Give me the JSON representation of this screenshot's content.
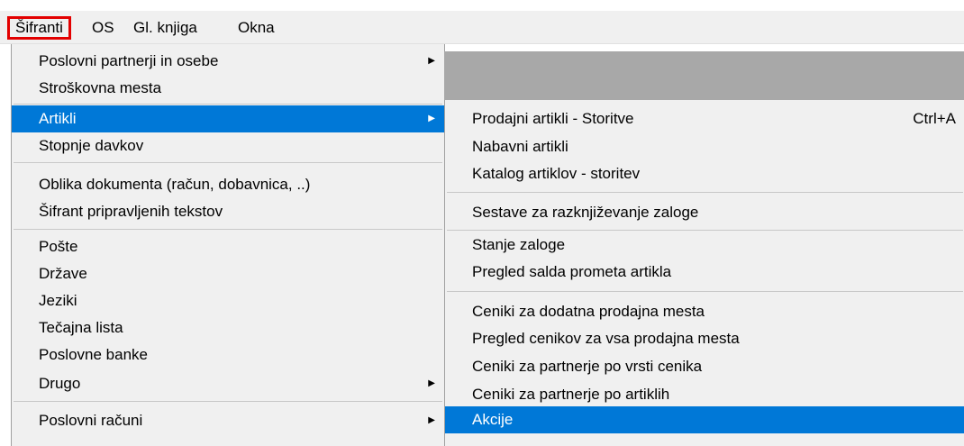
{
  "menubar": {
    "items": [
      {
        "label": "Šifranti",
        "active": true
      },
      {
        "label": "OS",
        "active": false
      },
      {
        "label": "Gl. knjiga",
        "active": false
      },
      {
        "label": "Okna",
        "active": false
      }
    ]
  },
  "main_menu": {
    "items": [
      {
        "label": "Poslovni partnerji in osebe",
        "submenu": true
      },
      {
        "label": "Stroškovna mesta"
      },
      {
        "label": "Artikli",
        "submenu": true,
        "selected": true
      },
      {
        "label": "Stopnje davkov"
      },
      {
        "label": "Oblika dokumenta (račun, dobavnica, ..)"
      },
      {
        "label": "Šifrant pripravljenih tekstov"
      },
      {
        "label": "Pošte"
      },
      {
        "label": "Države"
      },
      {
        "label": "Jeziki"
      },
      {
        "label": "Tečajna lista"
      },
      {
        "label": "Poslovne banke"
      },
      {
        "label": "Drugo",
        "submenu": true
      },
      {
        "label": "Poslovni računi",
        "submenu": true
      }
    ]
  },
  "submenu": {
    "items": [
      {
        "label": "Prodajni artikli - Storitve",
        "shortcut": "Ctrl+A"
      },
      {
        "label": "Nabavni artikli"
      },
      {
        "label": "Katalog artiklov - storitev"
      },
      {
        "label": "Sestave za razknjiževanje zaloge"
      },
      {
        "label": "Stanje zaloge"
      },
      {
        "label": "Pregled salda prometa artikla"
      },
      {
        "label": "Ceniki za dodatna prodajna mesta"
      },
      {
        "label": "Pregled cenikov za vsa prodajna mesta"
      },
      {
        "label": "Ceniki za partnerje po vrsti cenika"
      },
      {
        "label": "Ceniki za partnerje po artiklih"
      },
      {
        "label": "Akcije",
        "selected": true
      }
    ]
  },
  "icons": {
    "submenu_arrow": "chevron-right-icon"
  },
  "colors": {
    "selection": "#0078d7",
    "highlight_border": "#e30000",
    "menu_bg": "#f0f0f0"
  }
}
